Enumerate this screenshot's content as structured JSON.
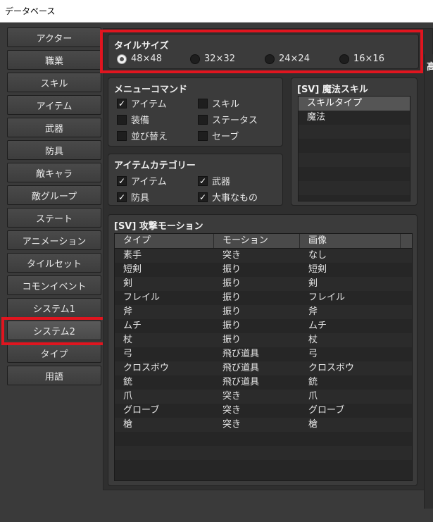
{
  "window": {
    "title": "データベース"
  },
  "sidebar": {
    "items": [
      {
        "label": "アクター"
      },
      {
        "label": "職業"
      },
      {
        "label": "スキル"
      },
      {
        "label": "アイテム"
      },
      {
        "label": "武器"
      },
      {
        "label": "防具"
      },
      {
        "label": "敵キャラ"
      },
      {
        "label": "敵グループ"
      },
      {
        "label": "ステート"
      },
      {
        "label": "アニメーション"
      },
      {
        "label": "タイルセット"
      },
      {
        "label": "コモンイベント"
      },
      {
        "label": "システム1"
      },
      {
        "label": "システム2"
      },
      {
        "label": "タイプ"
      },
      {
        "label": "用語"
      }
    ],
    "selected": "システム2"
  },
  "tile_size": {
    "title": "タイルサイズ",
    "options": [
      {
        "label": "48×48",
        "selected": true
      },
      {
        "label": "32×32",
        "selected": false
      },
      {
        "label": "24×24",
        "selected": false
      },
      {
        "label": "16×16",
        "selected": false
      }
    ]
  },
  "menu_commands": {
    "title": "メニューコマンド",
    "items": [
      {
        "label": "アイテム",
        "checked": true
      },
      {
        "label": "スキル",
        "checked": false
      },
      {
        "label": "装備",
        "checked": false
      },
      {
        "label": "ステータス",
        "checked": false
      },
      {
        "label": "並び替え",
        "checked": false
      },
      {
        "label": "セーブ",
        "checked": false
      }
    ]
  },
  "item_categories": {
    "title": "アイテムカテゴリー",
    "items": [
      {
        "label": "アイテム",
        "checked": true
      },
      {
        "label": "武器",
        "checked": true
      },
      {
        "label": "防具",
        "checked": true
      },
      {
        "label": "大事なもの",
        "checked": true
      }
    ]
  },
  "magic_skills": {
    "title": "[SV] 魔法スキル",
    "header": "スキルタイプ",
    "items": [
      "魔法"
    ]
  },
  "attack_motions": {
    "title": "[SV] 攻撃モーション",
    "columns": [
      "タイプ",
      "モーション",
      "画像"
    ],
    "rows": [
      [
        "素手",
        "突き",
        "なし"
      ],
      [
        "短剣",
        "振り",
        "短剣"
      ],
      [
        "剣",
        "振り",
        "剣"
      ],
      [
        "フレイル",
        "振り",
        "フレイル"
      ],
      [
        "斧",
        "振り",
        "斧"
      ],
      [
        "ムチ",
        "振り",
        "ムチ"
      ],
      [
        "杖",
        "振り",
        "杖"
      ],
      [
        "弓",
        "飛び道具",
        "弓"
      ],
      [
        "クロスボウ",
        "飛び道具",
        "クロスボウ"
      ],
      [
        "銃",
        "飛び道具",
        "銃"
      ],
      [
        "爪",
        "突き",
        "爪"
      ],
      [
        "グローブ",
        "突き",
        "グローブ"
      ],
      [
        "槍",
        "突き",
        "槍"
      ]
    ]
  },
  "right_panel": {
    "title_fragment": "高"
  },
  "colors": {
    "highlight": "#e0151f",
    "background": "#3a3a3a"
  }
}
